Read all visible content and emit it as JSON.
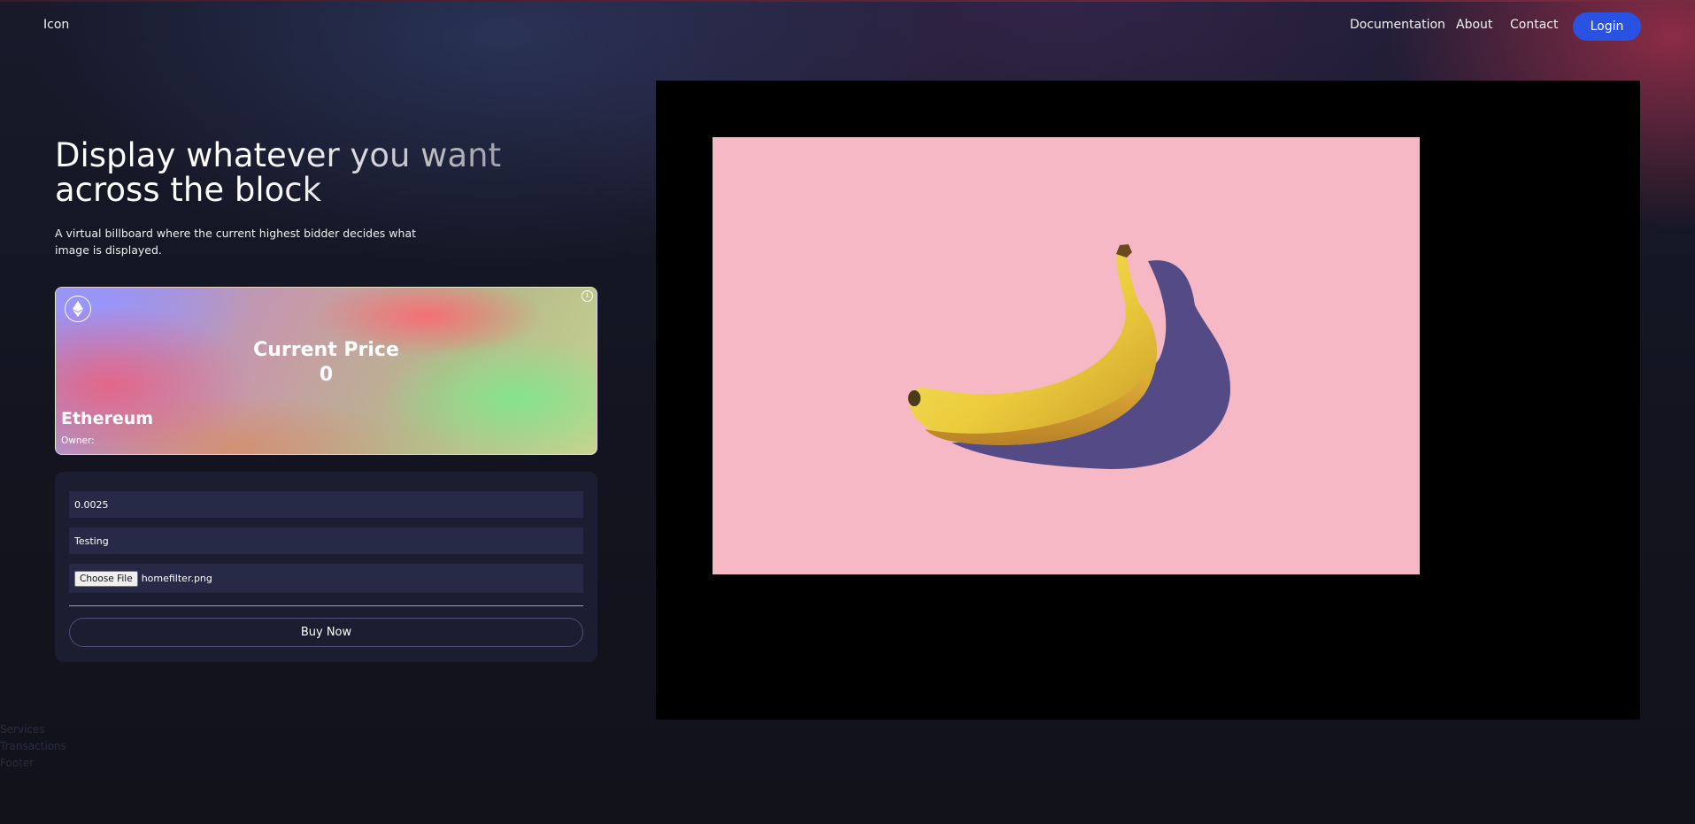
{
  "header": {
    "logo": "Icon",
    "nav": [
      "Documentation",
      "About",
      "Contact"
    ],
    "login_label": "Login"
  },
  "hero": {
    "title_line1": "Display whatever you want",
    "title_line2": "across the block",
    "subtitle": "A virtual billboard where the current highest bidder decides what image is displayed."
  },
  "price_card": {
    "icon": "ethereum-icon",
    "info_icon": "info-icon",
    "info_glyph": "i",
    "price_label": "Current Price",
    "price_value": "0",
    "coin_name": "Ethereum",
    "owner_label": "Owner:"
  },
  "form": {
    "price_value": "0.0025",
    "text_value": "Testing",
    "file_button_label": "Choose File",
    "file_name": "homefilter.png",
    "buy_label": "Buy Now"
  },
  "billboard": {
    "image_subject": "banana-on-pink-background",
    "background_color": "#f7b8c5"
  },
  "footer": {
    "links": [
      "Services",
      "Transactions",
      "Footer"
    ]
  },
  "colors": {
    "accent": "#2952e3",
    "panel": "#1b1d31",
    "field": "#262a47"
  }
}
